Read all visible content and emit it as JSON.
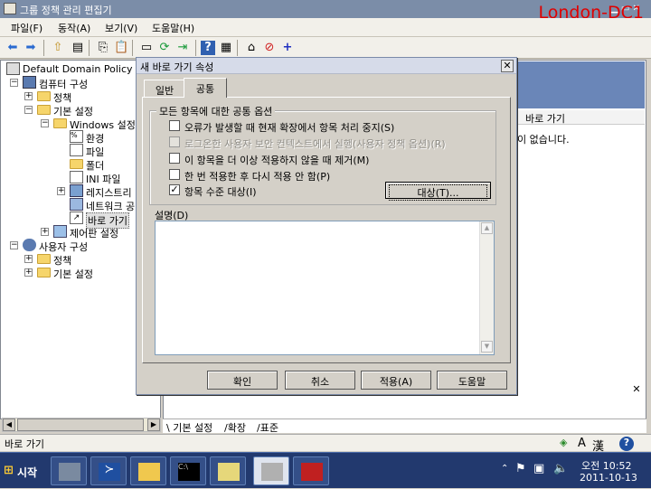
{
  "window": {
    "title": "그룹 정책 관리 편집기",
    "hostname": "London-DC1"
  },
  "menubar": {
    "items": [
      "파일(F)",
      "동작(A)",
      "보기(V)",
      "도움말(H)"
    ]
  },
  "toolbar": {
    "icons": [
      "back-icon",
      "forward-icon",
      "up-folder-icon",
      "show-hide-tree-icon",
      "copy-icon",
      "paste-icon",
      "properties-icon",
      "refresh-icon",
      "export-list-icon",
      "help-icon",
      "show-action-pane-icon",
      "new-item-icon",
      "delete-icon",
      "add-icon"
    ]
  },
  "tree": {
    "root": "Default Domain Policy [l",
    "computer_config": "컴퓨터 구성",
    "policies": "정책",
    "preferences": "기본 설정",
    "windows_settings": "Windows 설정",
    "environment": "환경",
    "files": "파일",
    "folders": "폴더",
    "ini_files": "INI 파일",
    "registry": "레지스트리",
    "network_shares": "네트워크 공",
    "shortcuts": "바로 가기",
    "control_panel": "제어판 설정",
    "user_config": "사용자 구성",
    "user_policies": "정책",
    "user_preferences": "기본 설정"
  },
  "right_pane": {
    "column_header": "바로 가기",
    "empty_message": "이 없습니다."
  },
  "bottom_tabs": [
    "기본 설정",
    "확장",
    "표준"
  ],
  "statusbar": {
    "text": "바로 가기"
  },
  "dialog": {
    "title": "새 바로 가기 속성",
    "tabs": [
      "일반",
      "공통"
    ],
    "active_tab": "공통",
    "group_title": "모든 항목에 대한 공통 옵션",
    "options": [
      {
        "label": "오류가 발생할 때 현재 확장에서 항목 처리 중지(S)",
        "checked": false,
        "disabled": false
      },
      {
        "label": "로그온한 사용자 보안 컨텍스트에서 실행(사용자 정책 옵션)(R)",
        "checked": false,
        "disabled": true
      },
      {
        "label": "이 항목을 더 이상 적용하지 않을 때 제거(M)",
        "checked": false,
        "disabled": false
      },
      {
        "label": "한 번 적용한 후 다시 적용 안 함(P)",
        "checked": false,
        "disabled": false
      },
      {
        "label": "항목 수준 대상(I)",
        "checked": true,
        "disabled": false
      }
    ],
    "target_button": "대상(T)...",
    "description_label": "설명(D)",
    "description_value": "",
    "buttons": {
      "ok": "확인",
      "cancel": "취소",
      "apply": "적용(A)",
      "help": "도움말"
    }
  },
  "taskbar": {
    "start_label": "시작",
    "apps": [
      "server-manager-icon",
      "powershell-icon",
      "explorer-icon",
      "command-prompt-icon",
      "notepad-icon",
      "group-policy-icon",
      "toolbox-icon"
    ],
    "time": "오전 10:52",
    "date": "2011-10-13"
  },
  "langbar": {
    "ime_a": "A",
    "ime_hanja": "漢"
  },
  "colors": {
    "title_bar": "#7b8da8",
    "taskbar": "#22396e",
    "hostname": "#e00000",
    "right_pane_header": "#6a86b8"
  }
}
